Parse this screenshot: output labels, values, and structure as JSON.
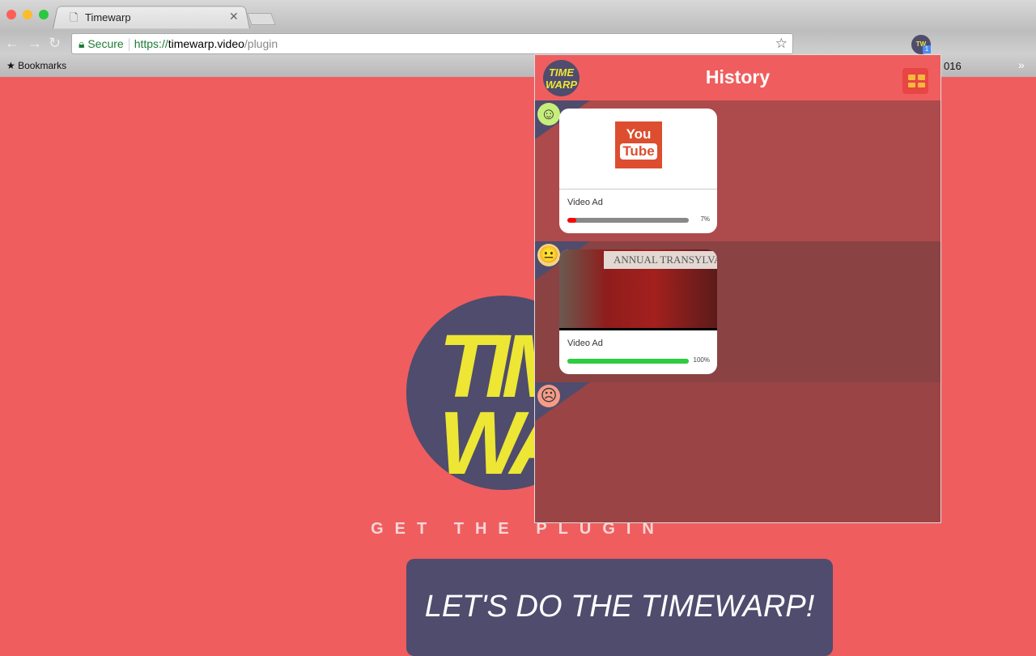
{
  "browser": {
    "tab_title": "Timewarp",
    "secure_label": "Secure",
    "url_scheme": "https://",
    "url_host": "timewarp.video",
    "url_path": "/plugin",
    "bookmarks_label": "Bookmarks",
    "bookmark_partial": "016",
    "extension_badge": "1"
  },
  "page": {
    "logo_text": "TIME WARP",
    "tagline": "GET THE PLUGIN",
    "cta": "LET'S DO THE TIMEWARP!"
  },
  "popup": {
    "title": "History",
    "logo_text": "TIME WARP",
    "items": [
      {
        "mood": "happy",
        "face": "☺",
        "face_color": "#c6ee7a",
        "row_color": "#ad4a4b",
        "thumbnail": "youtube-logo",
        "yt_top": "You",
        "yt_bottom": "Tube",
        "title": "Video Ad",
        "progress": 7,
        "progress_label": "7%",
        "bar_color": "#ff0000"
      },
      {
        "mood": "neutral",
        "face": "😐",
        "face_color": "#f6d47f",
        "row_color": "#8a4243",
        "thumbnail": "movie-still",
        "banner": "ANNUAL TRANSYLVA",
        "title": "Video Ad",
        "progress": 100,
        "progress_label": "100%",
        "bar_color": "#2ecc40"
      },
      {
        "mood": "sad",
        "face": "☹",
        "face_color": "#f59b87",
        "row_color": "#9a4445"
      }
    ]
  },
  "colors": {
    "brand_red": "#f05d5e",
    "brand_navy": "#4f4c6e",
    "brand_yellow": "#ede634"
  }
}
